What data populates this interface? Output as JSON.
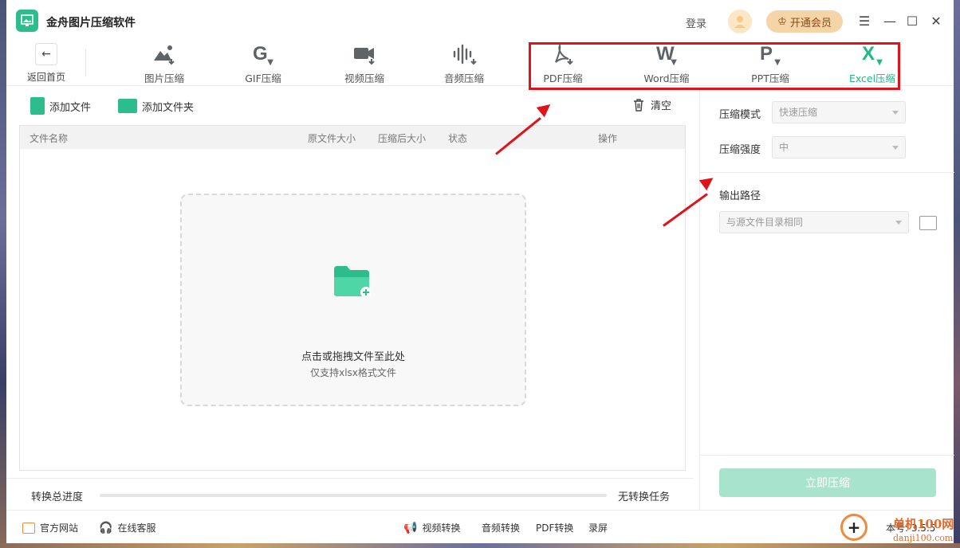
{
  "app": {
    "title": "金舟图片压缩软件",
    "login": "登录",
    "vip": "开通会员"
  },
  "toolbar": {
    "back_label": "返回首页",
    "tools": [
      {
        "label": "图片压缩",
        "glyph": "",
        "icon": "image-compress-icon"
      },
      {
        "label": "GIF压缩",
        "glyph": "G",
        "icon": "gif-compress-icon"
      },
      {
        "label": "视频压缩",
        "glyph": "",
        "icon": "video-compress-icon"
      },
      {
        "label": "音频压缩",
        "glyph": "",
        "icon": "audio-compress-icon"
      },
      {
        "label": "PDF压缩",
        "glyph": "",
        "icon": "pdf-compress-icon"
      },
      {
        "label": "Word压缩",
        "glyph": "W",
        "icon": "word-compress-icon"
      },
      {
        "label": "PPT压缩",
        "glyph": "P",
        "icon": "ppt-compress-icon"
      },
      {
        "label": "Excel压缩",
        "glyph": "X",
        "icon": "excel-compress-icon",
        "active": true
      }
    ]
  },
  "files": {
    "add_file": "添加文件",
    "add_folder": "添加文件夹",
    "clear": "清空",
    "columns": [
      "文件名称",
      "原文件大小",
      "压缩后大小",
      "状态",
      "操作"
    ],
    "drop_main": "点击或拖拽文件至此处",
    "drop_sub": "仅支持xlsx格式文件"
  },
  "progress": {
    "label": "转换总进度",
    "value": 0,
    "status": "无转换任务"
  },
  "settings": {
    "mode_label": "压缩模式",
    "mode_value": "快速压缩",
    "strength_label": "压缩强度",
    "strength_value": "中",
    "output_label": "输出路径",
    "output_value": "与源文件目录相同",
    "compress_button": "立即压缩"
  },
  "footer": {
    "website": "官方网站",
    "support": "在线客服",
    "links": [
      "视频转换",
      "音频转换",
      "PDF转换",
      "录屏"
    ],
    "version": "本号: 3.5.5"
  },
  "watermark": {
    "site": "单机100网",
    "url": "danji100.com"
  },
  "colors": {
    "accent": "#2dbd8c",
    "annotation": "#e0121a",
    "vip_bg": "#f5d5a8"
  }
}
